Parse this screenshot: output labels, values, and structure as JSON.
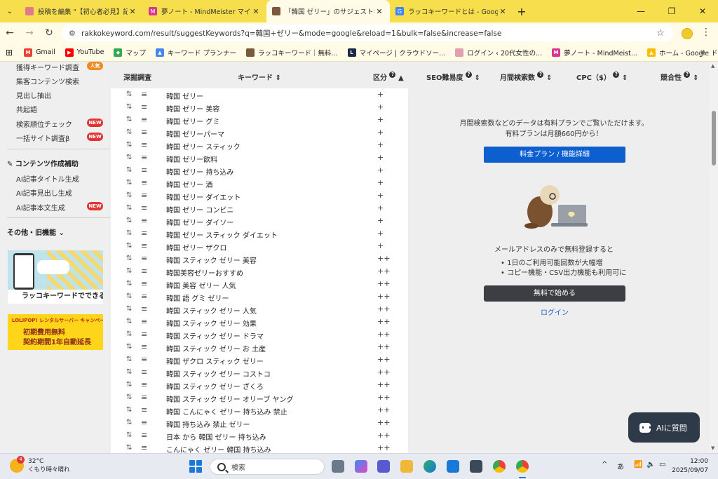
{
  "browser": {
    "tabs": [
      {
        "title": "投稿を編集 \"【初心者必見】記事ネ",
        "favicon_color": "#e07a8a",
        "favicon_text": ""
      },
      {
        "title": "夢ノート - MindMeister マインドマ",
        "favicon_color": "#d9378f",
        "favicon_text": "M"
      },
      {
        "title": "「韓国 ゼリー」のサジェストキーワード",
        "favicon_color": "#7a5a3a",
        "favicon_text": ""
      },
      {
        "title": "ラッコキーワードとは - Google 検索",
        "favicon_color": "#4285f4",
        "favicon_text": "G"
      }
    ],
    "tab_close": "✕",
    "new_tab": "+",
    "url": "rakkokeyword.com/result/suggestKeywords?q=韓国+ゼリー&mode=google&reload=1&bulk=false&increase=false",
    "bookmarks": [
      {
        "label": "Gmail",
        "color": "#ea4335",
        "icon": "M"
      },
      {
        "label": "YouTube",
        "color": "#ff0000",
        "icon": "▶"
      },
      {
        "label": "マップ",
        "color": "#34a853",
        "icon": "◆"
      },
      {
        "label": "キーワード プランナー",
        "color": "#4285f4",
        "icon": "▲"
      },
      {
        "label": "ラッコキーワード｜無料...",
        "color": "#7a5a3a",
        "icon": ""
      },
      {
        "label": "マイページ | クラウドソー...",
        "color": "#1b2a4a",
        "icon": "L"
      },
      {
        "label": "ログイン ‹ 20代女性の...",
        "color": "#e0a0b0",
        "icon": ""
      },
      {
        "label": "夢ノート - MindMeist...",
        "color": "#d9378f",
        "icon": "M"
      },
      {
        "label": "ホーム - Google ドライブ",
        "color": "#fbbc04",
        "icon": "▲"
      }
    ],
    "more": "»"
  },
  "sidebar": {
    "items_top": [
      {
        "label": "獲得キーワード調査",
        "badge": "人気",
        "badge_type": "pop"
      },
      {
        "label": "集客コンテンツ検索",
        "badge": "",
        "badge_type": ""
      },
      {
        "label": "見出し抽出",
        "badge": "",
        "badge_type": ""
      },
      {
        "label": "共起語",
        "badge": "",
        "badge_type": ""
      },
      {
        "label": "検索順位チェック",
        "badge": "NEW",
        "badge_type": "new"
      },
      {
        "label": "一括サイト調査β",
        "badge": "NEW",
        "badge_type": "new"
      }
    ],
    "section_content": "コンテンツ作成補助",
    "items_content": [
      {
        "label": "AI記事タイトル生成",
        "badge": ""
      },
      {
        "label": "AI記事見出し生成",
        "badge": ""
      },
      {
        "label": "AI記事本文生成",
        "badge": "NEW"
      }
    ],
    "section_other": "その他・旧機能",
    "banner1_caption": "ラッコキーワードでできること",
    "banner2_top": "LOLIPOP! レンタルサーバー キャンペーン中！",
    "banner2_line1": "初期費用無料",
    "banner2_line2": "契約期間1年自動延長"
  },
  "table": {
    "headers": {
      "deep": "深掘調査",
      "keyword": "キーワード ⇕",
      "category": "区分",
      "seo": "SEO難易度",
      "volume": "月間検索数",
      "cpc": "CPC（$）",
      "competition": "競合性"
    },
    "rows": [
      {
        "keyword": "韓国 ゼリー",
        "level": "+"
      },
      {
        "keyword": "韓国 ゼリー 美容",
        "level": "+"
      },
      {
        "keyword": "韓国 ゼリー グミ",
        "level": "+"
      },
      {
        "keyword": "韓国 ゼリーパーマ",
        "level": "+"
      },
      {
        "keyword": "韓国 ゼリー スティック",
        "level": "+"
      },
      {
        "keyword": "韓国 ゼリー飲料",
        "level": "+"
      },
      {
        "keyword": "韓国 ゼリー 持ち込み",
        "level": "+"
      },
      {
        "keyword": "韓国 ゼリー 酒",
        "level": "+"
      },
      {
        "keyword": "韓国 ゼリー ダイエット",
        "level": "+"
      },
      {
        "keyword": "韓国 ゼリー コンビニ",
        "level": "+"
      },
      {
        "keyword": "韓国 ゼリー ダイソー",
        "level": "+"
      },
      {
        "keyword": "韓国 ゼリー スティック ダイエット",
        "level": "+"
      },
      {
        "keyword": "韓国 ゼリー ザクロ",
        "level": "+"
      },
      {
        "keyword": "韓国 スティック ゼリー 美容",
        "level": "++"
      },
      {
        "keyword": "韓国美容ゼリーおすすめ",
        "level": "++"
      },
      {
        "keyword": "韓国 美容 ゼリー 人気",
        "level": "++"
      },
      {
        "keyword": "韓国 語 グミ ゼリー",
        "level": "++"
      },
      {
        "keyword": "韓国 スティック ゼリー 人気",
        "level": "++"
      },
      {
        "keyword": "韓国 スティック ゼリー 効果",
        "level": "++"
      },
      {
        "keyword": "韓国 スティック ゼリー ドラマ",
        "level": "++"
      },
      {
        "keyword": "韓国 スティック ゼリー お 土産",
        "level": "++"
      },
      {
        "keyword": "韓国 ザクロ スティック ゼリー",
        "level": "++"
      },
      {
        "keyword": "韓国 スティック ゼリー コストコ",
        "level": "++"
      },
      {
        "keyword": "韓国 スティック ゼリー ざくろ",
        "level": "++"
      },
      {
        "keyword": "韓国 スティック ゼリー オリーブ ヤング",
        "level": "++"
      },
      {
        "keyword": "韓国 こんにゃく ゼリー 持ち込み 禁止",
        "level": "++"
      },
      {
        "keyword": "韓国 持ち込み 禁止 ゼリー",
        "level": "++"
      },
      {
        "keyword": "日本 から 韓国 ゼリー 持ち込み",
        "level": "++"
      },
      {
        "keyword": "こんにゃく ゼリー 韓国 持ち込み",
        "level": "++"
      }
    ]
  },
  "promo": {
    "line1": "月間検索数などのデータは有料プランでご覧いただけます。",
    "line2": "有料プランは月額660円から！",
    "pricing_button": "料金プラン / 機能詳細",
    "register_text": "メールアドレスのみで無料登録すると",
    "bullet1": "1日のご利用可能回数が大幅増",
    "bullet2": "コピー機能・CSV出力機能も利用可に",
    "free_button": "無料で始める",
    "login": "ログイン"
  },
  "ai_button": "AIに質問",
  "taskbar": {
    "weather_badge": "4",
    "temperature": "32°C",
    "weather_desc": "くもり時々晴れ",
    "search_placeholder": "検索",
    "ime": "あ",
    "time": "12:00",
    "date": "2025/09/07"
  }
}
